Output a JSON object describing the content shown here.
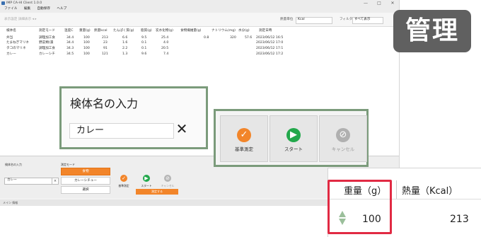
{
  "app": {
    "title": "IMP CA-HI Client 1.0.0",
    "menu": [
      "ファイル",
      "編集",
      "自動保存",
      "ヘルプ"
    ],
    "toolbar_left": "表示設定 詳細表示 ◂ ▸",
    "unit_label": "熱量単位",
    "unit_value": "Kcal",
    "filter_label": "フィルタ",
    "filter_value": "すべて表示"
  },
  "table": {
    "headers": [
      "検体名",
      "測定モード",
      "温度C",
      "重量(g)",
      "熱量kcal",
      "たんぱく質(g)",
      "脂質(g)",
      "炭水化物(g)",
      "食物繊維量(g)",
      "ナトリウム(mg)",
      "水分(g)",
      "測定日時"
    ],
    "rows": [
      [
        "弁当",
        "調理加工食",
        "34.4",
        "100",
        "213",
        "6.6",
        "9.5",
        "25.4",
        "0.8",
        "320",
        "57.6",
        "2023/06/12 16:5"
      ],
      [
        "たまねぎマリネ",
        "野菜類(漬",
        "34.4",
        "100",
        "23",
        "1.6",
        "0.1",
        "4.0",
        "",
        "",
        "",
        "2023/06/12 17:0"
      ],
      [
        "タコのマリネ",
        "調理加工食",
        "34.3",
        "100",
        "91",
        "2.2",
        "0.1",
        "20.5",
        "",
        "",
        "",
        "2023/06/12 17:1"
      ],
      [
        "カレー",
        "カレーシチ",
        "34.5",
        "100",
        "121",
        "1.3",
        "9.6",
        "7.4",
        "",
        "",
        "",
        "2023/06/12 17:2"
      ]
    ]
  },
  "bottom_panel": {
    "name_label": "検体名の入力",
    "name_value": "カレー",
    "clear": "×",
    "mode_label": "測定モード",
    "modes": [
      "食物",
      "カレーシチュー",
      "選択"
    ],
    "buttons": {
      "standard": "基準測定",
      "start": "スタート",
      "cancel": "キャンセル"
    },
    "status_button": "測定する"
  },
  "statusbar": "メイン 情報",
  "callouts": {
    "kanri": "管理",
    "name_title": "検体名の入力",
    "name_value": "カレー",
    "name_clear": "✕",
    "standard": "基準測定",
    "start": "スタート",
    "cancel": "キャンセル",
    "weight_header": "重量（g）",
    "kcal_header": "熱量（Kcal）",
    "weight_value": "100",
    "kcal_value": "213"
  },
  "colors": {
    "orange": "#f2852a",
    "green": "#22a84b",
    "gray": "#9a9a9a",
    "callout_border": "#7b9b7b",
    "highlight": "#e12a43"
  }
}
